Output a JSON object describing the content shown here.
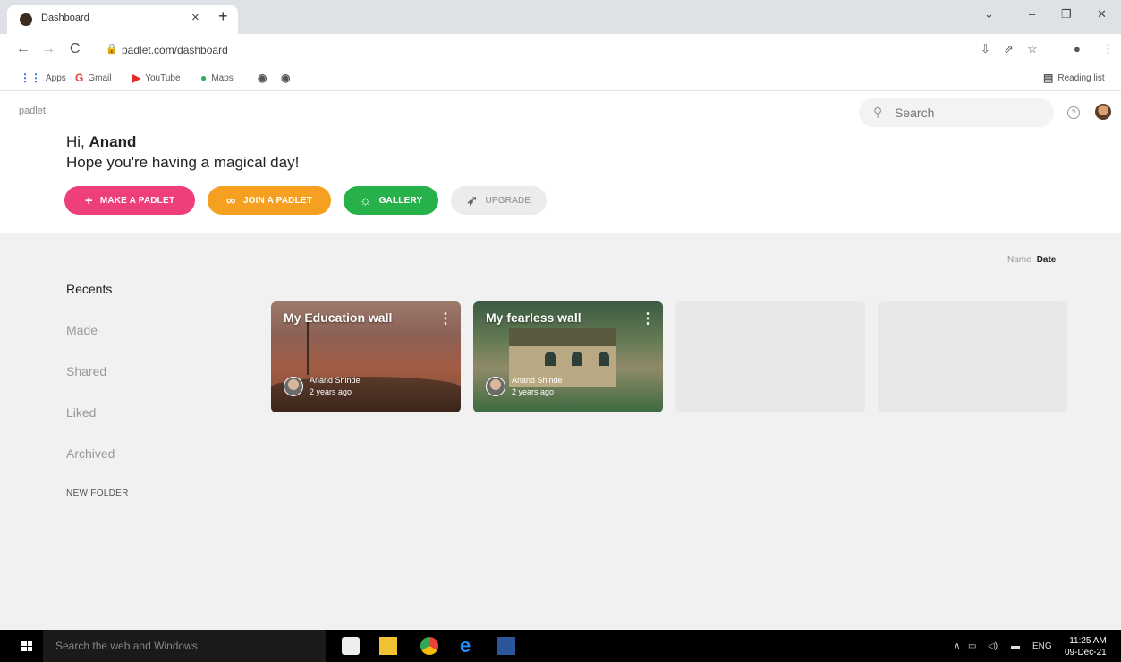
{
  "browser": {
    "tab_title": "Dashboard",
    "url": "padlet.com/dashboard",
    "bookmarks": [
      "Apps",
      "Gmail",
      "YouTube",
      "Maps"
    ],
    "reading_list": "Reading list"
  },
  "header": {
    "logo": "padlet",
    "search_placeholder": "Search"
  },
  "greeting": {
    "hi": "Hi,",
    "name": "Anand",
    "subtitle": "Hope you're having a magical day!"
  },
  "actions": [
    {
      "label": "MAKE A PADLET",
      "color": "#ee3f7c"
    },
    {
      "label": "JOIN A PADLET",
      "color": "#f5a020"
    },
    {
      "label": "GALLERY",
      "color": "#27b14b"
    },
    {
      "label": "UPGRADE",
      "color": "#ececec"
    }
  ],
  "sort": {
    "name": "Name",
    "date": "Date"
  },
  "sidebar": {
    "recents": "Recents",
    "made": "Made",
    "shared": "Shared",
    "liked": "Liked",
    "archived": "Archived",
    "new_folder": "NEW FOLDER"
  },
  "cards": [
    {
      "title": "My Education wall",
      "author": "Anand Shinde",
      "time": "2 years ago"
    },
    {
      "title": "My fearless wall",
      "author": "Anand Shinde",
      "time": "2 years ago"
    }
  ],
  "taskbar": {
    "search_placeholder": "Search the web and Windows",
    "language": "ENG",
    "time": "11:25 AM",
    "date": "09-Dec-21"
  }
}
